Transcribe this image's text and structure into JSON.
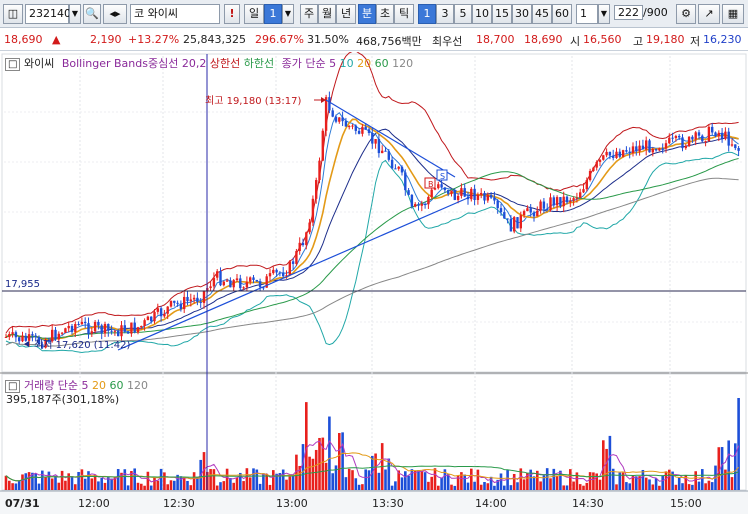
{
  "toolbar": {
    "code": "232140",
    "market": "코",
    "name": "와이씨",
    "period_day": "일",
    "period_count": "1",
    "periods": [
      "주",
      "월",
      "년",
      "분",
      "초",
      "틱"
    ],
    "minutes": [
      "1",
      "3",
      "5",
      "10",
      "15",
      "30",
      "45",
      "60"
    ],
    "interval_value": "1",
    "view_count": "222",
    "view_total": "/900"
  },
  "quote": {
    "price": "18,690",
    "change_arrow": "▲",
    "change": "2,190",
    "change_pct": "+13.27%",
    "volume": "25,843,325",
    "volume_ratio": "296.67%",
    "turnover": "31.50%",
    "trade_amount": "468,756백만",
    "best_ask_label": "최우선",
    "best_ask": "18,700",
    "best_bid": "18,690",
    "open_label": "시",
    "open": "16,560",
    "high_label": "고",
    "high": "19,180",
    "low_label": "저",
    "low": "16,230"
  },
  "price_panel": {
    "stock_label": "와이씨",
    "bb_label": "Bollinger Bands중심선 20,2",
    "bb_upper": "상한선",
    "bb_lower": "하한선",
    "ma_label": "종가 단순 5",
    "ma_10": "10",
    "ma_20": "20",
    "ma_60": "60",
    "ma_120": "120",
    "high_marker": "최고 19,180 (13:17)",
    "low_marker": "최저 17,620 (11:42)",
    "crosshair_price": "17,955"
  },
  "volume_panel": {
    "label": "거래량 단순 5",
    "ma_20": "20",
    "ma_60": "60",
    "ma_120": "120",
    "value": "395,187주(301,18%)"
  },
  "time_axis": [
    "07/31",
    "12:00",
    "12:30",
    "13:00",
    "13:30",
    "14:00",
    "14:30",
    "15:00"
  ],
  "colors": {
    "up": "#e8201d",
    "down": "#1d4fd8",
    "bb_band": "#c0181c",
    "bb_mid": "#1c2d8a",
    "ma5": "#2e7bd6",
    "ma10": "#22a8a8",
    "ma20": "#e39a17",
    "ma60": "#2a9a4a",
    "ma120": "#888888"
  }
}
